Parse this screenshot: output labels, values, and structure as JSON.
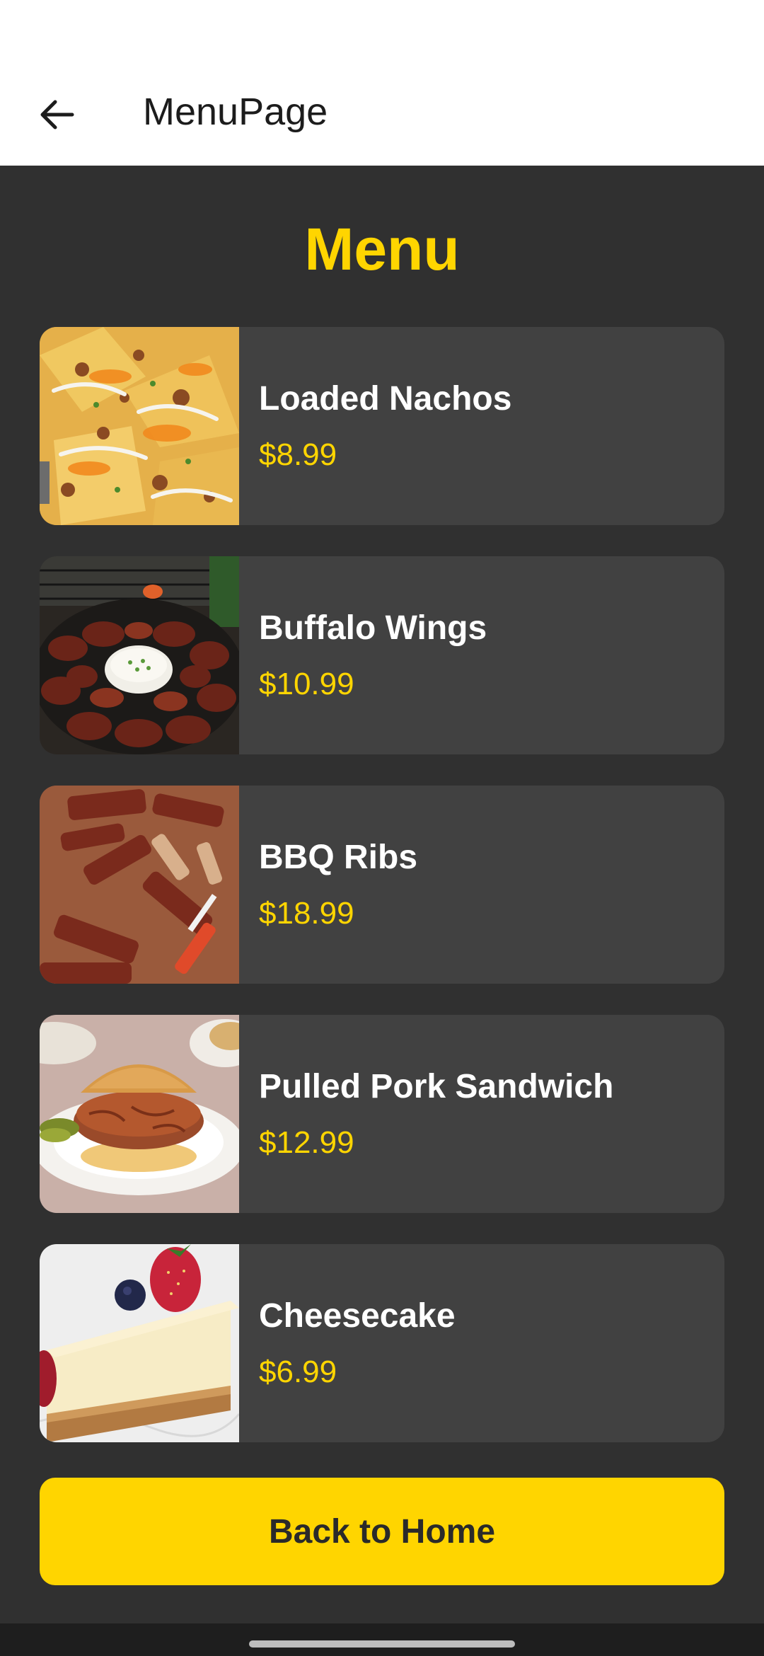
{
  "app_bar": {
    "title": "MenuPage",
    "back_icon": "arrow-left-icon"
  },
  "heading": "Menu",
  "accent_color": "#FFD500",
  "menu_items": [
    {
      "name": "Loaded Nachos",
      "price": "$8.99",
      "image": "nachos-image"
    },
    {
      "name": "Buffalo Wings",
      "price": "$10.99",
      "image": "wings-image"
    },
    {
      "name": "BBQ Ribs",
      "price": "$18.99",
      "image": "ribs-image"
    },
    {
      "name": "Pulled Pork Sandwich",
      "price": "$12.99",
      "image": "sandwich-image"
    },
    {
      "name": "Cheesecake",
      "price": "$6.99",
      "image": "cheesecake-image"
    }
  ],
  "home_button": {
    "label": "Back to Home"
  }
}
